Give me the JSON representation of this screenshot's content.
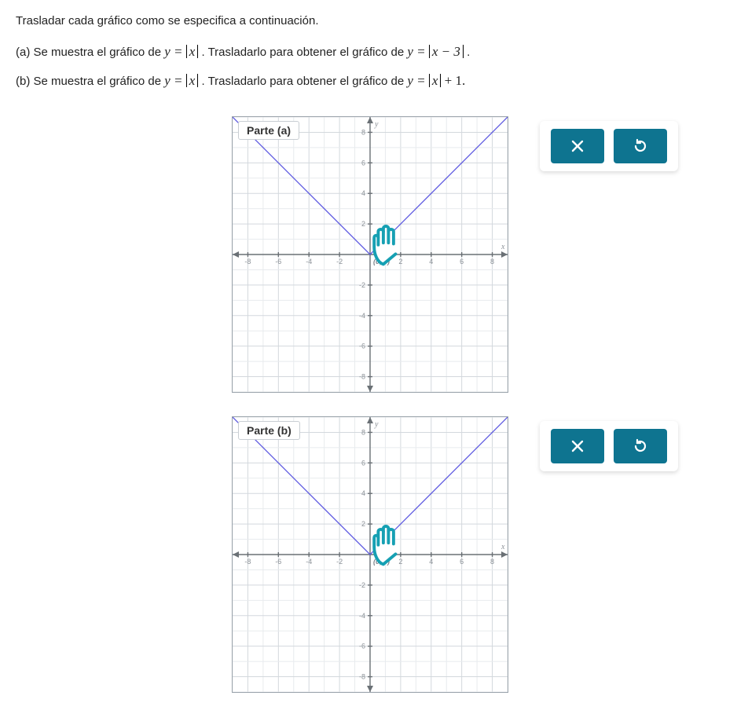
{
  "instruction": "Trasladar cada gráfico como se especifica a continuación.",
  "parts": {
    "a": {
      "prefix": "(a) Se muestra el gráfico de ",
      "eq1_lhs": "y = ",
      "eq1_abs": "x",
      "mid": ". Trasladarlo para obtener el gráfico de ",
      "eq2_lhs": "y = ",
      "eq2_abs": "x − 3",
      "suffix": "."
    },
    "b": {
      "prefix": "(b) Se muestra el gráfico de ",
      "eq1_lhs": "y = ",
      "eq1_abs": "x",
      "mid": ". Trasladarlo para obtener el gráfico de ",
      "eq2_lhs": "y = ",
      "eq2_abs": "x",
      "eq2_tail": " + 1.",
      "suffix": ""
    }
  },
  "chart_labels": {
    "a": "Parte (a)",
    "b": "Parte (b)"
  },
  "chart_data": [
    {
      "type": "line",
      "title": "Parte (a)",
      "xlabel": "x",
      "ylabel": "y",
      "xlim": [
        -9,
        9
      ],
      "ylim": [
        -9,
        9
      ],
      "xticks": [
        -8,
        -6,
        -4,
        -2,
        2,
        4,
        6,
        8
      ],
      "yticks": [
        -8,
        -6,
        -4,
        -2,
        2,
        4,
        6,
        8
      ],
      "vertex_label": "(0, 0)",
      "series": [
        {
          "name": "|x|",
          "x": [
            -9,
            0,
            9
          ],
          "y": [
            9,
            0,
            9
          ]
        }
      ]
    },
    {
      "type": "line",
      "title": "Parte (b)",
      "xlabel": "x",
      "ylabel": "y",
      "xlim": [
        -9,
        9
      ],
      "ylim": [
        -9,
        9
      ],
      "xticks": [
        -8,
        -6,
        -4,
        -2,
        2,
        4,
        6,
        8
      ],
      "yticks": [
        -8,
        -6,
        -4,
        -2,
        2,
        4,
        6,
        8
      ],
      "vertex_label": "(0, 0)",
      "series": [
        {
          "name": "|x|",
          "x": [
            -9,
            0,
            9
          ],
          "y": [
            9,
            0,
            9
          ]
        }
      ]
    }
  ],
  "buttons": {
    "clear": "×",
    "reset": "↺"
  }
}
